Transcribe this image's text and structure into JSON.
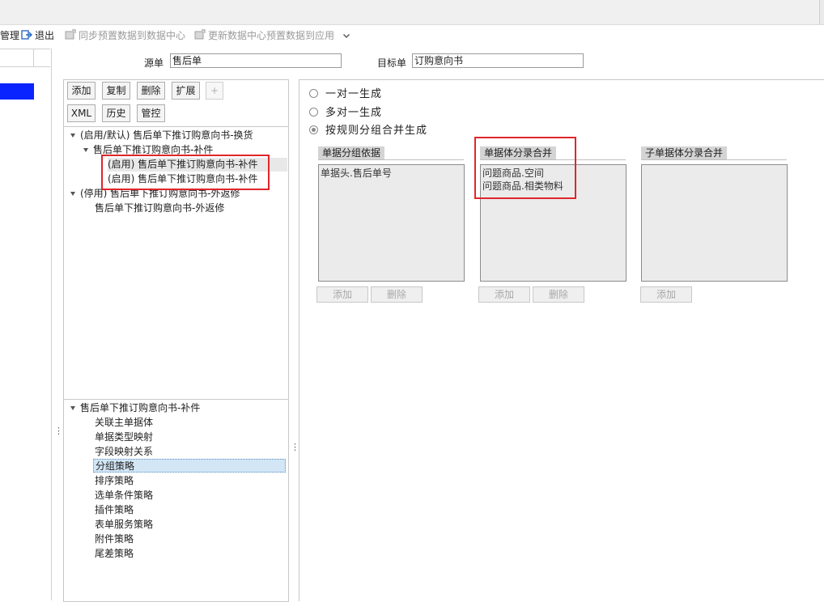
{
  "toolbar": {
    "manage_fragment": "管理",
    "exit_label": "退出",
    "sync_label": "同步预置数据到数据中心",
    "update_label": "更新数据中心预置数据到应用"
  },
  "form": {
    "source_label": "源单",
    "source_value": "售后单",
    "target_label": "目标单",
    "target_value": "订购意向书"
  },
  "buttons": {
    "add": "添加",
    "copy": "复制",
    "delete": "删除",
    "extend": "扩展",
    "plus": "+",
    "xml": "XML",
    "history": "历史",
    "control": "管控"
  },
  "rule_tree": {
    "group1": "(启用/默认) 售后单下推订购意向书-换货",
    "group1_child": "售后单下推订购意向书-补件",
    "group1_sub1": "(启用) 售后单下推订购意向书-补件",
    "group1_sub2": "(启用) 售后单下推订购意向书-补件",
    "group2": "(停用) 售后单下推订购意向书-外返修",
    "group2_child": "售后单下推订购意向书-外返修"
  },
  "strategy_tree": {
    "root": "售后单下推订购意向书-补件",
    "items": [
      "关联主单据体",
      "单据类型映射",
      "字段映射关系",
      "分组策略",
      "排序策略",
      "选单条件策略",
      "插件策略",
      "表单服务策略",
      "附件策略",
      "尾差策略"
    ],
    "selected": "分组策略"
  },
  "generation": {
    "options": [
      "一对一生成",
      "多对一生成",
      "按规则分组合并生成"
    ],
    "selected": "按规则分组合并生成"
  },
  "groups": {
    "bill_group": {
      "title": "单据分组依据",
      "items": [
        "单据头.售后单号"
      ],
      "add": "添加",
      "delete": "删除"
    },
    "entry_merge": {
      "title": "单据体分录合并",
      "items": [
        "问题商品.空间",
        "问题商品.相类物料"
      ],
      "add": "添加",
      "delete": "删除"
    },
    "sub_entry_merge": {
      "title": "子单据体分录合并",
      "items": [],
      "add": "添加"
    }
  },
  "colors": {
    "highlight_red": "#e0262b",
    "selection_blue": "#0a24ff"
  }
}
